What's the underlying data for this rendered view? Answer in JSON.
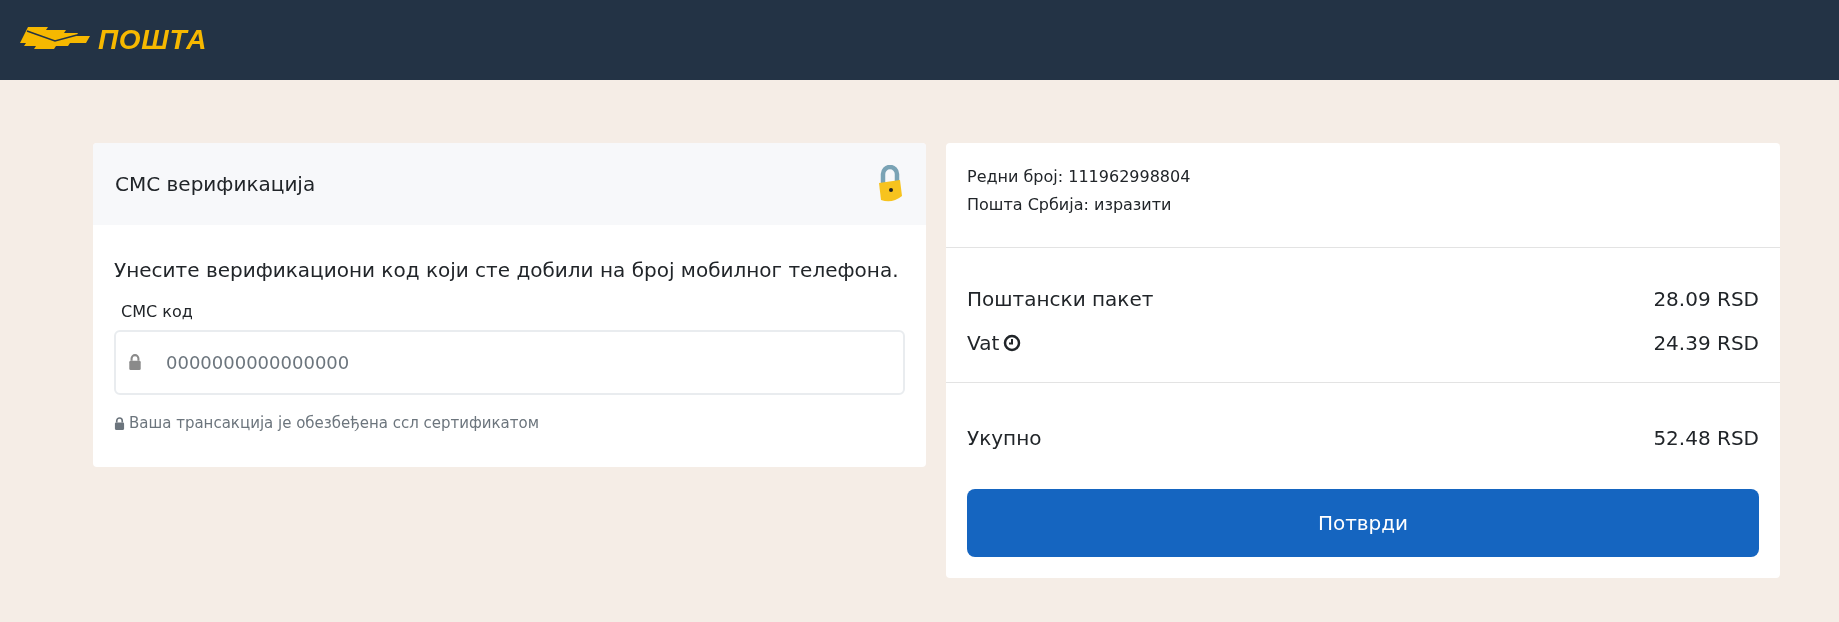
{
  "header": {
    "logo_text": "ПОШТА"
  },
  "verification": {
    "title": "СМС верификација",
    "instruction": "Унесите верификациони код који сте добили на број мобилног телефона.",
    "field_label": "СМС код",
    "placeholder": "0000000000000000",
    "security_note": "Ваша трансакција је обезбеђена ссл сертификатом"
  },
  "summary": {
    "info": [
      "Редни број: 111962998804",
      "Пошта Србија: изразити"
    ],
    "items": [
      {
        "label": "Поштански пакет",
        "amount": "28.09 RSD",
        "kind": "plain"
      },
      {
        "label": "Vat",
        "amount": "24.39 RSD",
        "kind": "clock"
      }
    ],
    "total": {
      "label": "Укупно",
      "amount": "52.48 RSD"
    },
    "button": "Потврди"
  }
}
